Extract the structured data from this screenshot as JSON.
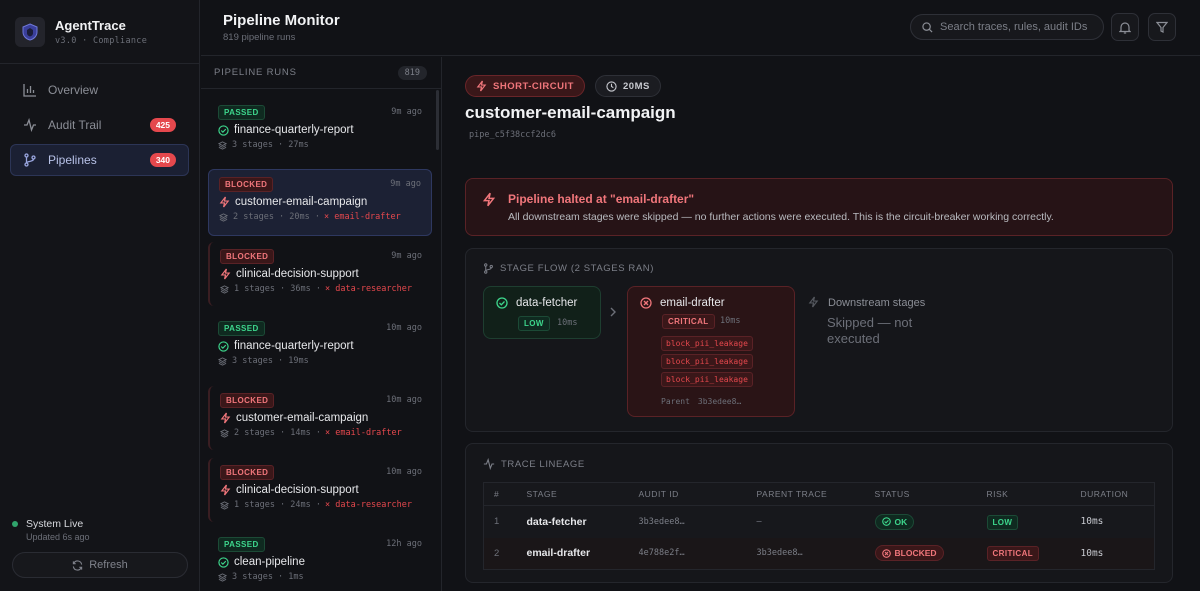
{
  "app": {
    "name": "AgentTrace",
    "version": "v3.0",
    "tagline": "Compliance"
  },
  "nav": [
    {
      "label": "Overview",
      "icon": "bar-chart-icon",
      "badge": ""
    },
    {
      "label": "Audit Trail",
      "icon": "activity-icon",
      "badge": "425"
    },
    {
      "label": "Pipelines",
      "icon": "git-branch-icon",
      "badge": "340",
      "active": true
    }
  ],
  "system": {
    "status": "System Live",
    "updated": "Updated 6s ago",
    "refresh_label": "Refresh"
  },
  "header": {
    "title": "Pipeline Monitor",
    "subtitle": "819 pipeline runs",
    "search_placeholder": "Search traces, rules, audit IDs"
  },
  "runs": {
    "title": "PIPELINE RUNS",
    "count": "819",
    "items": [
      {
        "status": "PASSED",
        "time": "9m ago",
        "name": "finance-quarterly-report",
        "meta": "3 stages · 27ms",
        "error": ""
      },
      {
        "status": "BLOCKED",
        "time": "9m ago",
        "name": "customer-email-campaign",
        "meta": "2 stages · 20ms ·",
        "error": "× email-drafter"
      },
      {
        "status": "BLOCKED",
        "time": "9m ago",
        "name": "clinical-decision-support",
        "meta": "1 stages · 36ms ·",
        "error": "× data-researcher"
      },
      {
        "status": "PASSED",
        "time": "10m ago",
        "name": "finance-quarterly-report",
        "meta": "3 stages · 19ms",
        "error": ""
      },
      {
        "status": "BLOCKED",
        "time": "10m ago",
        "name": "customer-email-campaign",
        "meta": "2 stages · 14ms ·",
        "error": "× email-drafter"
      },
      {
        "status": "BLOCKED",
        "time": "10m ago",
        "name": "clinical-decision-support",
        "meta": "1 stages · 24ms ·",
        "error": "× data-researcher"
      },
      {
        "status": "PASSED",
        "time": "12h ago",
        "name": "clean-pipeline",
        "meta": "3 stages · 1ms",
        "error": ""
      }
    ]
  },
  "detail": {
    "badge": "SHORT-CIRCUIT",
    "duration": "20MS",
    "title": "customer-email-campaign",
    "pipe_id": "pipe_c5f38ccf2dc6",
    "halt": {
      "title": "Pipeline halted at \"email-drafter\"",
      "text": "All downstream stages were skipped — no further actions were executed. This is the circuit-breaker working correctly."
    },
    "flow": {
      "title": "STAGE FLOW (2 STAGES RAN)",
      "stage1": {
        "name": "data-fetcher",
        "risk": "LOW",
        "ms": "10ms"
      },
      "stage2": {
        "name": "email-drafter",
        "risk": "CRITICAL",
        "ms": "10ms",
        "rules": [
          "block_pii_leakage",
          "block_pii_leakage",
          "block_pii_leakage"
        ],
        "parent_label": "Parent",
        "parent": "3b3edee8…"
      },
      "downstream_title": "Downstream stages",
      "downstream_text": "Skipped — not executed"
    },
    "lineage": {
      "title": "TRACE LINEAGE",
      "columns": [
        "#",
        "STAGE",
        "AUDIT ID",
        "PARENT TRACE",
        "STATUS",
        "RISK",
        "DURATION"
      ],
      "rows": [
        {
          "n": "1",
          "stage": "data-fetcher",
          "audit": "3b3edee8…",
          "parent": "—",
          "status": "OK",
          "risk": "LOW",
          "duration": "10ms"
        },
        {
          "n": "2",
          "stage": "email-drafter",
          "audit": "4e788e2f…",
          "parent": "3b3edee8…",
          "status": "BLOCKED",
          "risk": "CRITICAL",
          "duration": "10ms"
        }
      ]
    }
  },
  "colors": {
    "accent": "#5b6fd6",
    "danger": "#e5484d",
    "success": "#3dd68c",
    "background": "#111216"
  }
}
